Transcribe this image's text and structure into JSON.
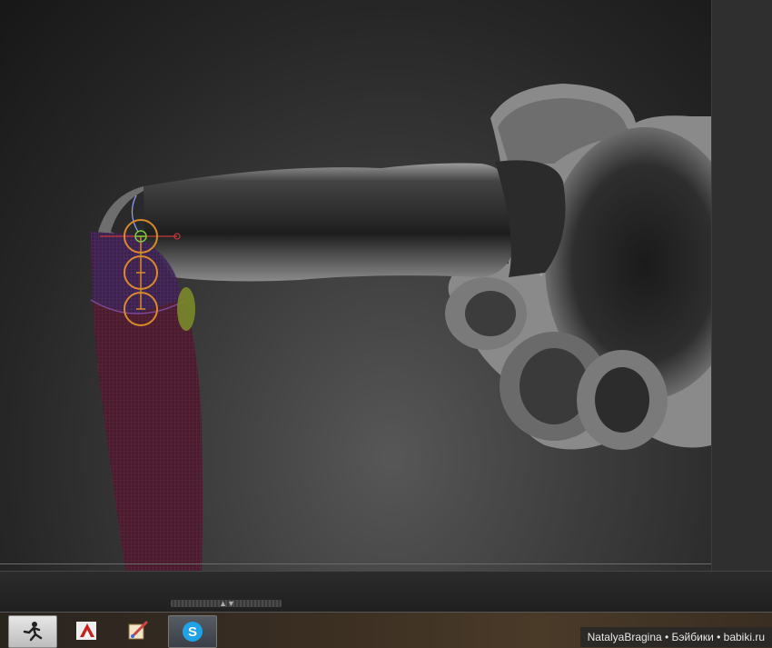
{
  "app": {
    "name": "ZBrush"
  },
  "viewport": {
    "model": "doll-arm-and-torso",
    "gizmo": "transpose-action-line",
    "colors": {
      "model_gray": "#8c8c8c",
      "sleeve_mesh": "#5a2236",
      "gizmo_orange": "#d98a2b",
      "gizmo_green": "#7acb3a"
    }
  },
  "taskbar": {
    "buttons": [
      {
        "id": "zbrush",
        "icon": "zbrush-running-man-icon",
        "state": "active"
      },
      {
        "id": "acrobat",
        "icon": "acrobat-icon",
        "state": "normal"
      },
      {
        "id": "paint",
        "icon": "paint-brush-icon",
        "state": "normal"
      },
      {
        "id": "skype",
        "icon": "skype-icon",
        "state": "pressed"
      }
    ]
  },
  "watermark": {
    "text": "NatalyaBragina • Бэйбики • babiki.ru"
  }
}
